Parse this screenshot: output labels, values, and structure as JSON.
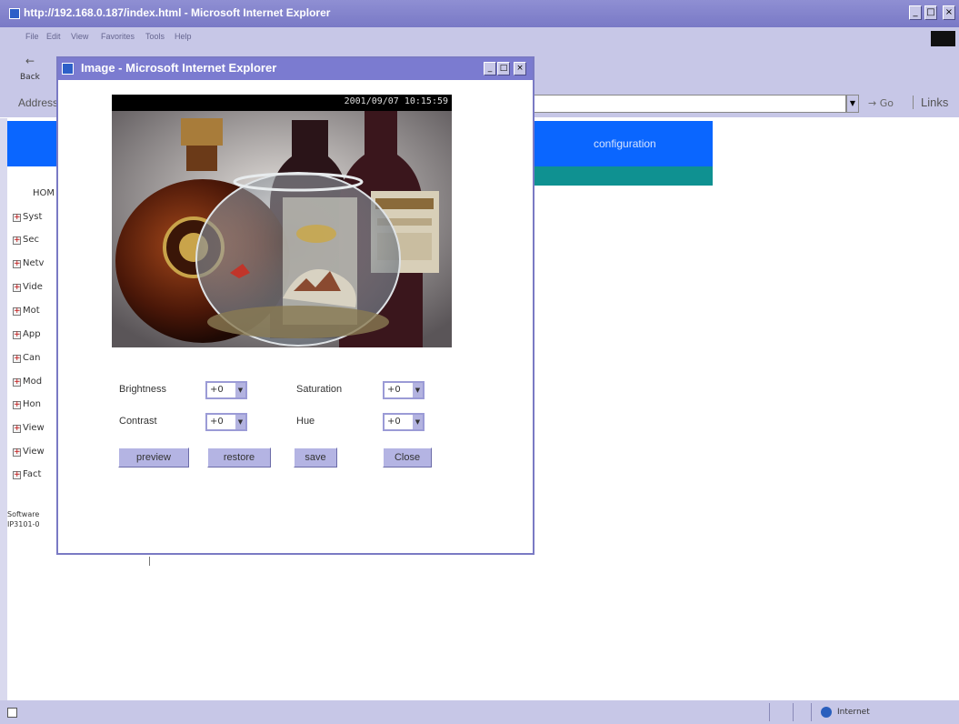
{
  "window": {
    "title": "http://192.168.0.187/index.html - Microsoft Internet Explorer",
    "min": "_",
    "max": "□",
    "close": "×"
  },
  "menu": [
    "File",
    "Edit",
    "View",
    "Favorites",
    "Tools",
    "Help"
  ],
  "toolbar": {
    "back_label": "Back"
  },
  "address_bar": {
    "label": "Address",
    "go_label": "Go",
    "links_label": "Links"
  },
  "page": {
    "banner_text": "configuration",
    "nav_home": "HOM",
    "nav_items": [
      "Syst",
      "Sec",
      "Netv",
      "Vide",
      "Mot",
      "App",
      "Can",
      "Mod",
      "Hon",
      "View",
      "View",
      "Fact"
    ],
    "software_text": [
      "Software",
      "IP3101-0"
    ]
  },
  "dialog": {
    "title": "Image - Microsoft Internet Explorer",
    "timestamp": "2001/09/07 10:15:59",
    "controls": {
      "brightness_label": "Brightness",
      "brightness_value": "+0",
      "saturation_label": "Saturation",
      "saturation_value": "+0",
      "contrast_label": "Contrast",
      "contrast_value": "+0",
      "hue_label": "Hue",
      "hue_value": "+0"
    },
    "buttons": {
      "preview": "preview",
      "restore": "restore",
      "save": "save",
      "close": "Close"
    }
  },
  "status": {
    "zone": "Internet"
  },
  "colors": {
    "chrome": "#c7c7e7",
    "titlebar": "#7b7bd0",
    "banner_blue": "#0a66ff",
    "teal": "#0f9191",
    "button": "#b4b4e3"
  }
}
